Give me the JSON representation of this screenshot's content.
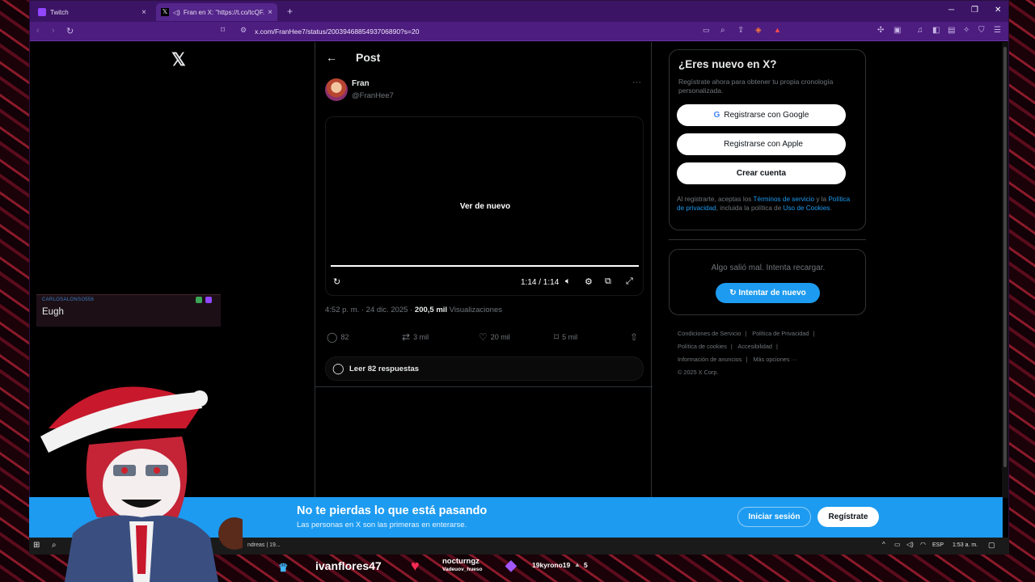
{
  "browser": {
    "tabs": [
      {
        "title": "Twitch",
        "icon": "twitch-icon"
      },
      {
        "title": "Fran en X: \"https://t.co/tcQF...",
        "icon": "x-icon"
      }
    ],
    "new_tab": "+",
    "url": "x.com/FranHee7/status/2003946885493706890?s=20"
  },
  "stream_chat": {
    "username": "CARLOSALONSO556",
    "message": "Eugh"
  },
  "post": {
    "header_title": "Post",
    "author_name": "Fran",
    "author_handle": "@FranHee7",
    "video": {
      "replay_label": "Ver de nuevo",
      "time": "1:14 / 1:14",
      "progress": 1.0
    },
    "timestamp": "4:52 p. m. · 24 dic. 2025 · ",
    "views_count": "200,5 mil",
    "views_label": " Visualizaciones",
    "replies": "82",
    "reposts": "3 mil",
    "likes": "20 mil",
    "bookmarks": "5 mil",
    "read_replies": "Leer 82 respuestas"
  },
  "signup": {
    "title": "¿Eres nuevo en X?",
    "description": "Regístrate ahora para obtener tu propia cronología personalizada.",
    "google": "Registrarse con Google",
    "apple": "Registrarse con Apple",
    "create": "Crear cuenta",
    "legal_1": "Al registrarte, aceptas los ",
    "legal_terms": "Términos de servicio",
    "legal_2": " y la ",
    "legal_privacy": "Política de privacidad",
    "legal_3": ", incluida la política de ",
    "legal_cookies": "Uso de Cookies",
    "legal_4": "."
  },
  "error": {
    "message": "Algo salió mal. Intenta recargar.",
    "retry": "Intentar de nuevo"
  },
  "footer": {
    "links": [
      "Condiciones de Servicio",
      "Política de Privacidad",
      "Política de cookies",
      "Accesibilidad",
      "Información de anuncios",
      "Más opciones ···"
    ],
    "copyright": "© 2025 X Corp."
  },
  "banner": {
    "title": "No te pierdas lo que está pasando",
    "subtitle": "Las personas en X son las primeras en enterarse.",
    "login": "Iniciar sesión",
    "register": "Regístrate"
  },
  "taskbar": {
    "task_label": "ndreas | 19...",
    "language": "ESP",
    "clock": "1:53 a. m."
  },
  "stream_overlay": {
    "name_1": "ivanflores47",
    "name_2": "nocturngz",
    "name_2_sub": "Vadeuov_hueso",
    "name_3": "19kyrono19",
    "count_3": "5"
  },
  "colors": {
    "accent": "#1d9bf0",
    "browser": "#3b1466"
  }
}
